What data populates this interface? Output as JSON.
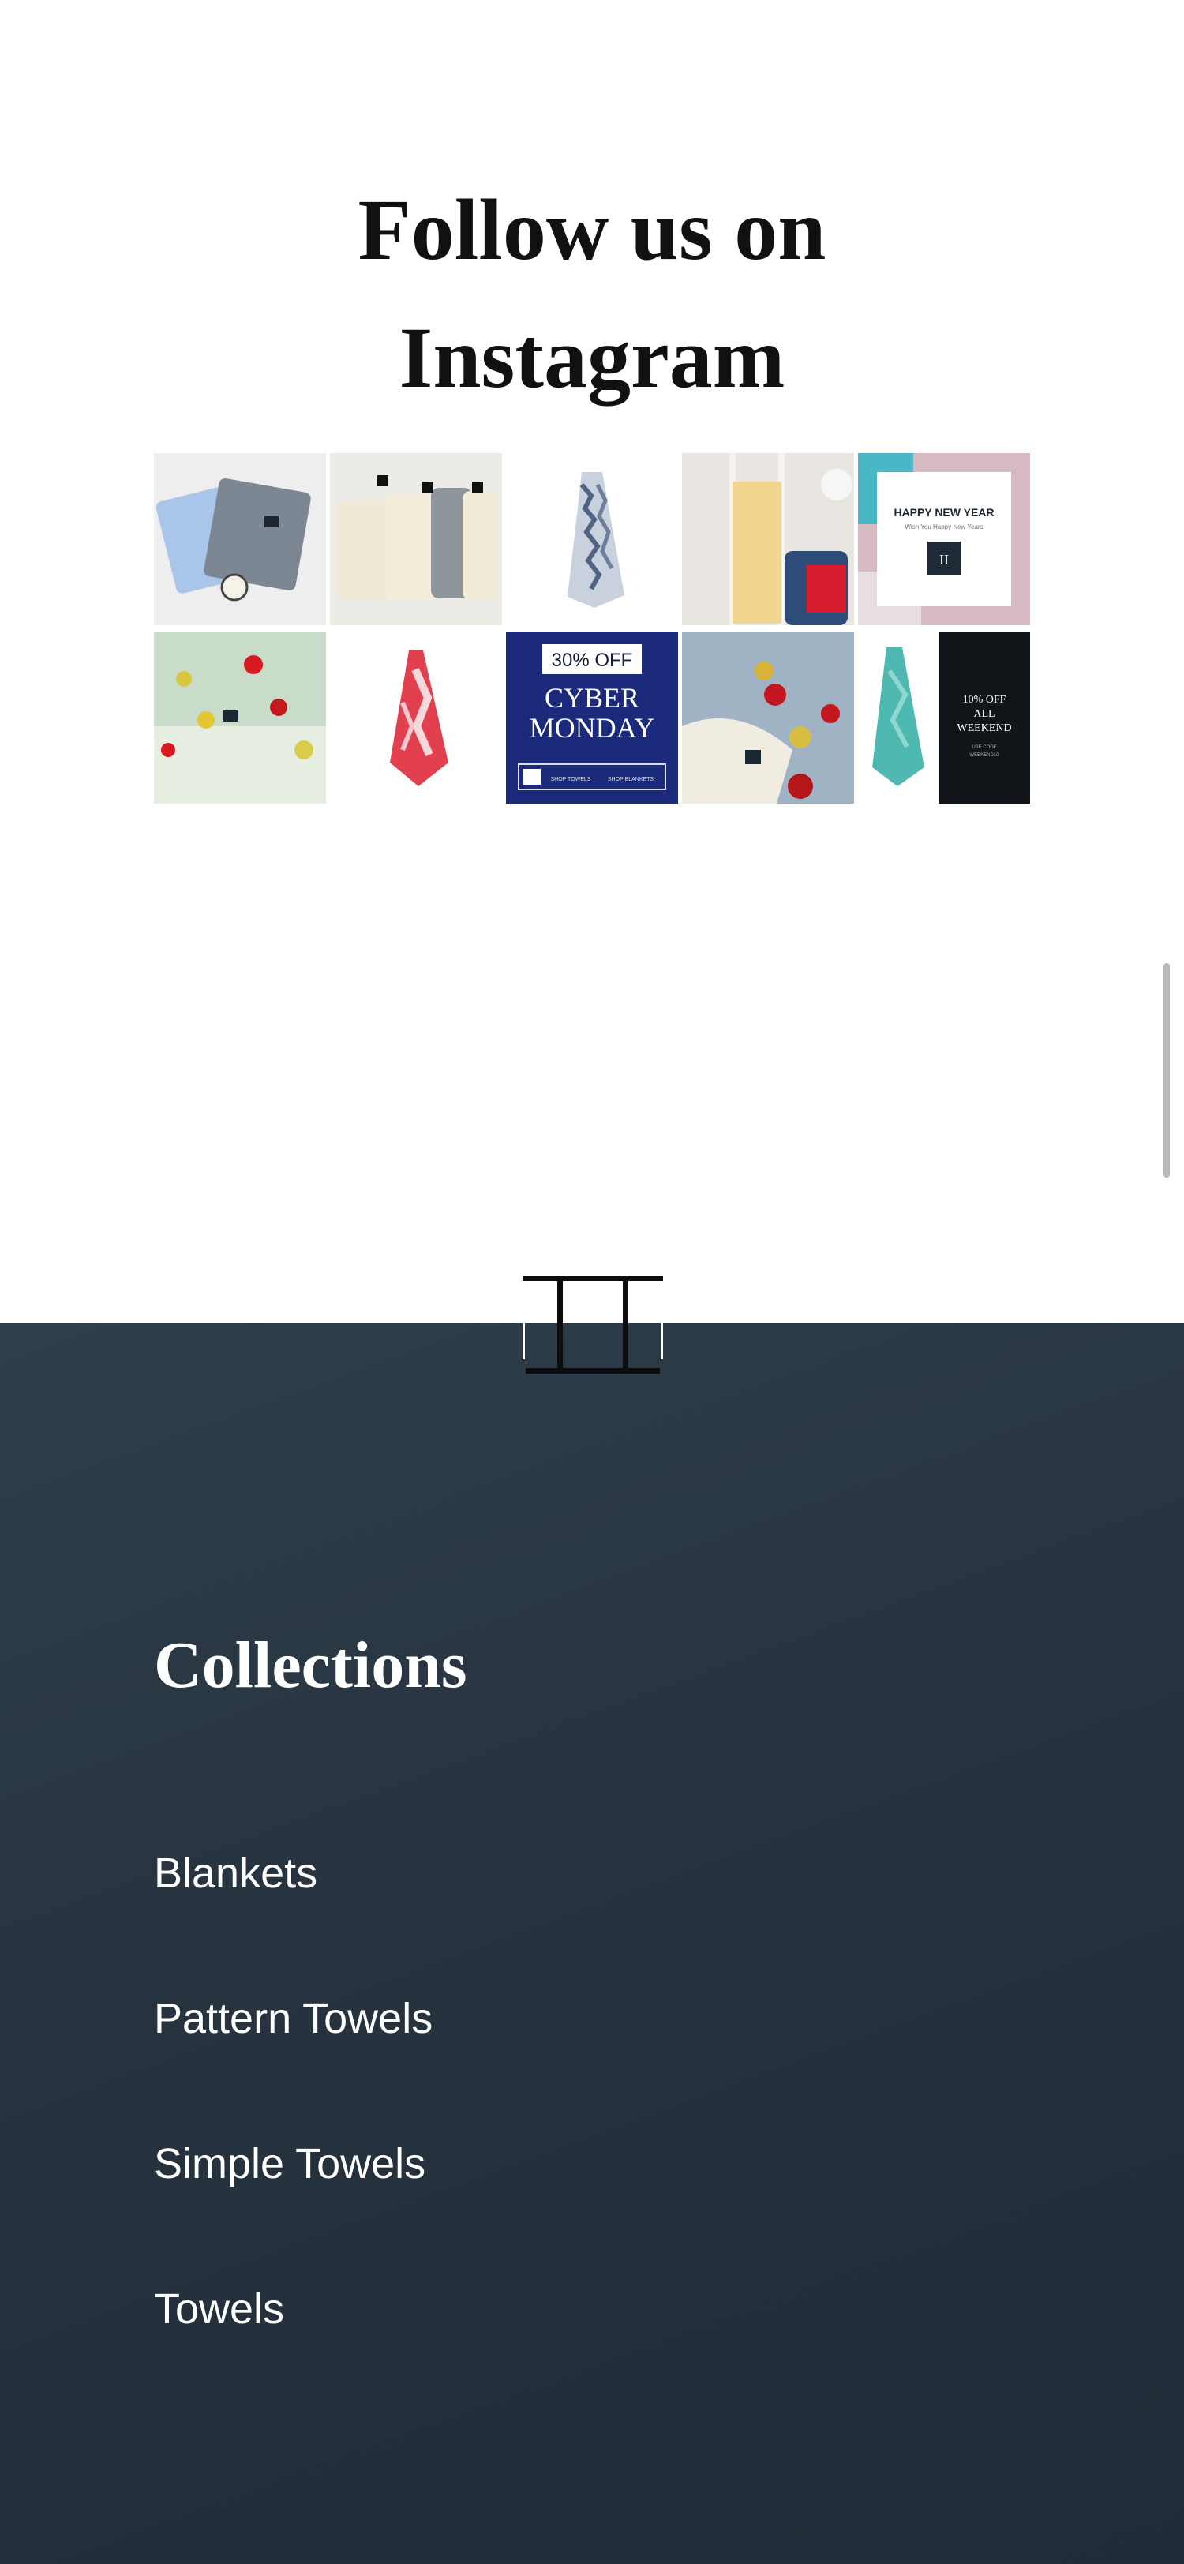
{
  "instagram": {
    "heading_line1": "Follow us on",
    "heading_line2": "Instagram",
    "posts": [
      {
        "alt": "blue and grey blankets with candle"
      },
      {
        "alt": "folded cream towels"
      },
      {
        "alt": "hanging grey pattern towel"
      },
      {
        "alt": "yellow throw on ladder"
      },
      {
        "alt": "happy new year card",
        "title": "HAPPY NEW YEAR",
        "subtitle": "Wish You Happy New Years"
      },
      {
        "alt": "green blanket with ornaments"
      },
      {
        "alt": "hanging red pattern towel"
      },
      {
        "alt": "cyber monday promotion",
        "badge": "30% OFF",
        "line1": "CYBER",
        "line2": "MONDAY",
        "left_note": "SHOP TOWELS",
        "right_note": "SHOP BLANKETS"
      },
      {
        "alt": "blue blanket with ornaments"
      },
      {
        "alt": "turquoise towel promotion",
        "promo1": "10% OFF",
        "promo2": "ALL",
        "promo3": "WEEKEND",
        "small1": "USE CODE",
        "small2": "WEEKEND10"
      }
    ]
  },
  "brand": {
    "logo_alt": "brand monogram logo"
  },
  "footer": {
    "collections_title": "Collections",
    "links": [
      "Blankets",
      "Pattern Towels",
      "Simple Towels",
      "Towels"
    ]
  },
  "colors": {
    "footer_bg": "#27333f",
    "text_dark": "#111111",
    "text_light": "#ffffff"
  }
}
